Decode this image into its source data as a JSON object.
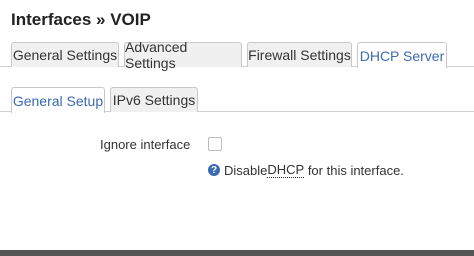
{
  "page": {
    "title": "Interfaces » VOIP"
  },
  "tabs": [
    {
      "label": "General Settings",
      "active": false
    },
    {
      "label": "Advanced Settings",
      "active": false
    },
    {
      "label": "Firewall Settings",
      "active": false
    },
    {
      "label": "DHCP Server",
      "active": true
    }
  ],
  "subtabs": [
    {
      "label": "General Setup",
      "active": true
    },
    {
      "label": "IPv6 Settings",
      "active": false
    }
  ],
  "form": {
    "ignore_label": "Ignore interface",
    "ignore_checked": false,
    "help_icon": "question-icon",
    "help_pre": "Disable ",
    "help_abbr": "DHCP",
    "help_post": " for this interface."
  },
  "colors": {
    "accent": "#3b6bb0",
    "tab_bg": "#f0f0f0"
  }
}
